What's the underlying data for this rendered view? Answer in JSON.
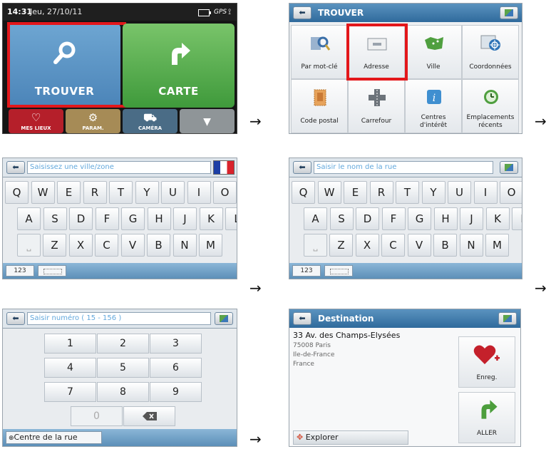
{
  "panel1": {
    "status": {
      "time": "14:31",
      "date": "Jeu, 27/10/11",
      "gps": "GPS"
    },
    "tiles": {
      "trouver": "TROUVER",
      "carte": "CARTE"
    },
    "small_tiles": {
      "mes_lieux": "MES LIEUX",
      "param": "PARAM.",
      "camera": "CAMÉRA"
    }
  },
  "panel2": {
    "title": "TROUVER",
    "tiles": [
      "Par mot-clé",
      "Adresse",
      "Ville",
      "Coordonnées",
      "Code postal",
      "Carrefour",
      "Centres\nd'intérêt",
      "Emplacements\nrécents"
    ]
  },
  "panel3": {
    "placeholder": "Saisissez une ville/zone"
  },
  "panel4": {
    "placeholder": "Saisir le nom de la rue"
  },
  "keyboard": {
    "row1": [
      "Q",
      "W",
      "E",
      "R",
      "T",
      "Y",
      "U",
      "I",
      "O",
      "P"
    ],
    "row2": [
      "A",
      "S",
      "D",
      "F",
      "G",
      "H",
      "J",
      "K",
      "L"
    ],
    "row3": [
      "Z",
      "X",
      "C",
      "V",
      "B",
      "N",
      "M"
    ],
    "numbers_label": "123"
  },
  "panel5": {
    "placeholder": "Saisir numéro ( 15 - 156 )",
    "keys": [
      "1",
      "2",
      "3",
      "4",
      "5",
      "6",
      "7",
      "8",
      "9",
      "0"
    ],
    "centre_label": "Centre de la rue"
  },
  "panel6": {
    "title": "Destination",
    "address": [
      "33 Av. des Champs-Elysées",
      "75008 Paris",
      "Ile-de-France",
      "France"
    ],
    "explorer": "Explorer",
    "save_label": "Enreg.",
    "go_label": "ALLER"
  },
  "arrow": "→",
  "colors": {
    "highlight": "#e3171b",
    "titlebar": "#2f6a9c",
    "trouver": "#5b94c6",
    "carte": "#52aa49",
    "mes_lieux": "#b51f2a",
    "param": "#a68b56",
    "camera": "#4a6c86"
  }
}
